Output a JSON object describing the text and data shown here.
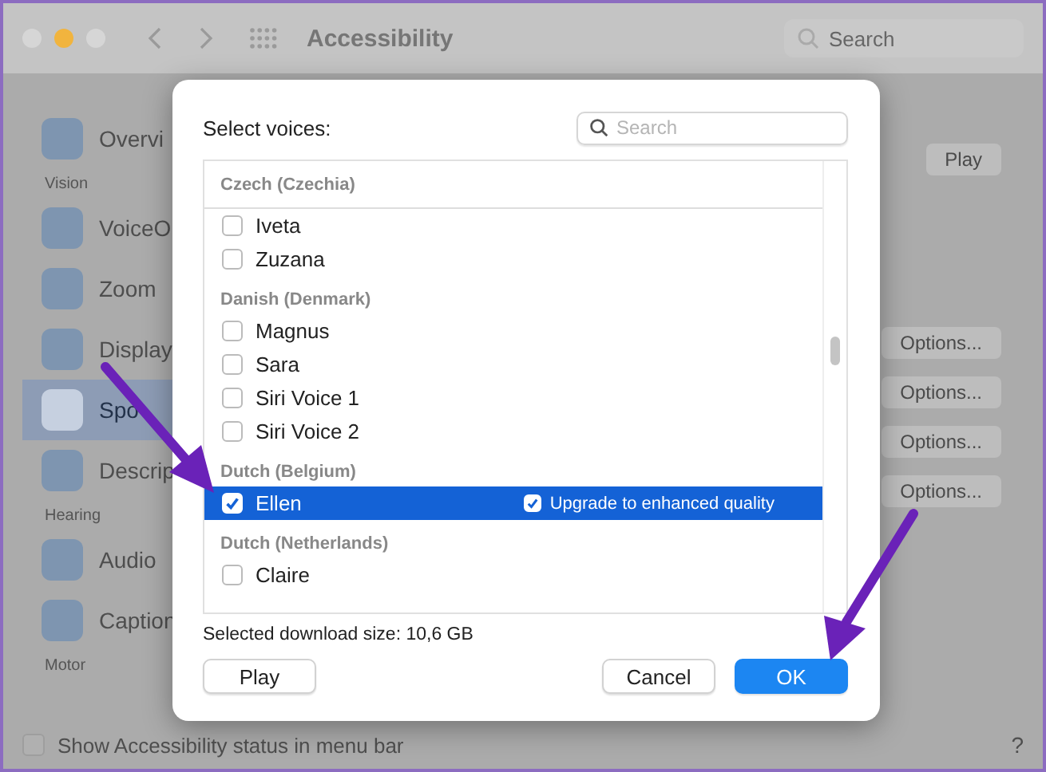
{
  "window": {
    "title": "Accessibility",
    "search_placeholder": "Search"
  },
  "sidebar": {
    "items": [
      {
        "kind": "item",
        "label": "Overvi",
        "selected": false
      },
      {
        "kind": "section",
        "label": "Vision"
      },
      {
        "kind": "item",
        "label": "VoiceO",
        "selected": false
      },
      {
        "kind": "item",
        "label": "Zoom",
        "selected": false
      },
      {
        "kind": "item",
        "label": "Display",
        "selected": false
      },
      {
        "kind": "item",
        "label": "Spo",
        "selected": true
      },
      {
        "kind": "item",
        "label": "Descrip",
        "selected": false
      },
      {
        "kind": "section",
        "label": "Hearing"
      },
      {
        "kind": "item",
        "label": "Audio",
        "selected": false
      },
      {
        "kind": "item",
        "label": "Caption",
        "selected": false
      },
      {
        "kind": "section",
        "label": "Motor"
      }
    ]
  },
  "right_panel": {
    "play_button": "Play",
    "options_buttons": [
      "Options...",
      "Options...",
      "Options...",
      "Options..."
    ]
  },
  "footer": {
    "checkbox": {
      "label": "Show Accessibility status in menu bar",
      "checked": false
    },
    "help": "?"
  },
  "dialog": {
    "title": "Select voices:",
    "search_placeholder": "Search",
    "groups": [
      {
        "header": "Czech (Czechia)",
        "voices": [
          {
            "name": "Iveta",
            "checked": false,
            "selected": false
          },
          {
            "name": "Zuzana",
            "checked": false,
            "selected": false
          }
        ]
      },
      {
        "header": "Danish (Denmark)",
        "voices": [
          {
            "name": "Magnus",
            "checked": false,
            "selected": false
          },
          {
            "name": "Sara",
            "checked": false,
            "selected": false
          },
          {
            "name": "Siri Voice 1",
            "checked": false,
            "selected": false
          },
          {
            "name": "Siri Voice 2",
            "checked": false,
            "selected": false
          }
        ]
      },
      {
        "header": "Dutch (Belgium)",
        "voices": [
          {
            "name": "Ellen",
            "checked": true,
            "selected": true,
            "upgrade": {
              "label": "Upgrade to enhanced quality",
              "checked": true
            }
          }
        ]
      },
      {
        "header": "Dutch (Netherlands)",
        "voices": [
          {
            "name": "Claire",
            "checked": false,
            "selected": false
          }
        ]
      }
    ],
    "download_size": "Selected download size: 10,6 GB",
    "buttons": {
      "play": "Play",
      "cancel": "Cancel",
      "ok": "OK"
    }
  }
}
